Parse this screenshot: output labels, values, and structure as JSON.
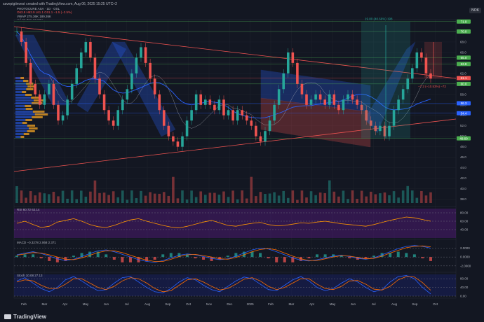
{
  "header": {
    "text": "savepigtinvest created with TradingView.com, Aug 06, 2025 15:25 UTC+2"
  },
  "legend": {
    "symbol": "PHOTOCURE ASA · 1D · OSL",
    "ohlc": "O63.9 H63.9 L61.1 C61.1 −1.5 (−2.5%)",
    "vwap": "VWAP 275.36K  189.26K",
    "vol": "Vol  96.78K  82.53K",
    "sma1": "SMA  56.7",
    "sma2": "SMA  54.4"
  },
  "currency": "NOK",
  "chart_data": {
    "type": "line",
    "title": "PHOTOCURE ASA · 1D · OSL",
    "x_ticks": [
      "Feb",
      "Mar",
      "Apr",
      "May",
      "Jun",
      "Jul",
      "Aug",
      "Sep",
      "Oct",
      "Nov",
      "Dec",
      "2025",
      "Feb",
      "Mar",
      "Apr",
      "May",
      "Jun",
      "Jul",
      "Aug",
      "Sep",
      "Oct"
    ],
    "price_axis": {
      "ylim": [
        37,
        72
      ],
      "ticks": [
        38,
        40,
        42,
        44,
        46,
        48,
        50,
        52,
        54,
        56,
        58,
        60,
        62,
        64,
        66,
        68,
        70
      ]
    },
    "price_labels": [
      {
        "text": "71.9",
        "value": 71.9,
        "color": "#4caf50"
      },
      {
        "text": "70.0",
        "value": 70.0,
        "color": "#4caf50"
      },
      {
        "text": "65.0",
        "value": 65.0,
        "color": "#4caf50"
      },
      {
        "text": "63.8",
        "value": 63.8,
        "color": "#4caf50"
      },
      {
        "text": "61.1",
        "value": 61.1,
        "color": "#ef5350"
      },
      {
        "text": "60.0",
        "value": 60.0,
        "color": "#4caf50"
      },
      {
        "text": "56.3",
        "value": 56.3,
        "color": "#2962ff"
      },
      {
        "text": "54.4",
        "value": 54.4,
        "color": "#2962ff"
      },
      {
        "text": "49.60",
        "value": 49.6,
        "color": "#4caf50"
      }
    ],
    "annotations": {
      "measure_up": "19.80 (40.66%) 198",
      "measure_down": "−7.2 (−10.53%) −72"
    },
    "price_close": [
      70,
      68,
      64,
      60,
      58,
      56,
      58,
      60,
      56,
      53,
      54,
      57,
      60,
      63,
      66,
      68,
      65,
      61,
      58,
      55,
      53,
      52,
      55,
      57,
      59,
      62,
      65,
      67,
      64,
      61,
      58,
      55,
      52,
      50,
      49,
      48,
      50,
      53,
      55,
      58,
      56,
      57,
      56,
      55,
      57,
      54,
      55,
      53,
      55,
      54,
      53,
      52,
      50,
      49,
      51,
      53,
      56,
      59,
      62,
      66,
      64,
      60,
      58,
      56,
      57,
      58,
      57,
      56,
      58,
      56,
      55,
      57,
      58,
      57,
      56,
      55,
      53,
      52,
      51,
      52,
      50,
      52,
      55,
      57,
      59,
      61,
      63,
      66,
      65,
      62,
      61
    ],
    "rsi": {
      "label": "RSI  60.72  62.14",
      "ylim": [
        20,
        90
      ],
      "ticks": [
        40,
        60,
        80
      ],
      "values": [
        55,
        60,
        52,
        45,
        48,
        58,
        62,
        66,
        60,
        52,
        47,
        45,
        50,
        57,
        63,
        66,
        60,
        55,
        50,
        46,
        44,
        48,
        53,
        58,
        62,
        56,
        50,
        48,
        52,
        55,
        57,
        52,
        49,
        50,
        53,
        56,
        55,
        58,
        60,
        57,
        54,
        52,
        50,
        48,
        52,
        57,
        62,
        66,
        70,
        68,
        64,
        60
      ]
    },
    "macd": {
      "label": "MACD  −0.3278  2.068  2.371",
      "ylim": [
        -2.5,
        3.5
      ],
      "ticks": [
        2.0,
        0.0,
        -2.0
      ],
      "macd": [
        0.5,
        0.9,
        1.2,
        0.8,
        0.2,
        -0.4,
        -0.8,
        -0.5,
        0.1,
        0.8,
        1.4,
        1.6,
        1.2,
        0.6,
        0,
        -0.6,
        -1.0,
        -1.2,
        -0.8,
        -0.2,
        0.4,
        0.7,
        0.5,
        0.1,
        -0.3,
        -0.6,
        -0.4,
        0.2,
        0.9,
        1.6,
        2.0,
        1.8,
        1.2,
        0.5,
        -0.2,
        -0.7,
        -0.9,
        -0.6,
        -0.2,
        0.2,
        0.4,
        0.1,
        -0.3,
        -0.5,
        -0.2,
        0.5,
        1.2,
        1.9,
        2.4,
        2.6,
        2.4,
        2.0
      ],
      "signal": [
        0.4,
        0.7,
        1.0,
        0.9,
        0.5,
        0,
        -0.5,
        -0.6,
        -0.2,
        0.4,
        1.0,
        1.4,
        1.4,
        1.0,
        0.4,
        -0.2,
        -0.7,
        -1.0,
        -1.0,
        -0.5,
        0.1,
        0.5,
        0.6,
        0.3,
        0,
        -0.4,
        -0.5,
        -0.1,
        0.5,
        1.2,
        1.7,
        1.9,
        1.6,
        0.9,
        0.2,
        -0.4,
        -0.8,
        -0.8,
        -0.4,
        0,
        0.3,
        0.2,
        -0.1,
        -0.4,
        -0.3,
        0.2,
        0.9,
        1.5,
        2.1,
        2.4,
        2.5,
        2.3
      ]
    },
    "stoch": {
      "label": "Stoch  10.08  27.13",
      "ylim": [
        0,
        100
      ],
      "ticks": [
        80,
        40,
        0
      ],
      "k": [
        70,
        85,
        60,
        35,
        20,
        40,
        75,
        90,
        70,
        45,
        25,
        30,
        60,
        85,
        90,
        65,
        40,
        20,
        15,
        35,
        65,
        85,
        75,
        50,
        30,
        20,
        45,
        70,
        88,
        80,
        55,
        30,
        25,
        50,
        75,
        90,
        70,
        40,
        25,
        35,
        60,
        80,
        65,
        40,
        20,
        30,
        65,
        90,
        95,
        80,
        40,
        10
      ],
      "d": [
        65,
        75,
        70,
        50,
        35,
        35,
        55,
        80,
        80,
        60,
        40,
        30,
        45,
        70,
        85,
        80,
        60,
        35,
        20,
        25,
        50,
        75,
        80,
        65,
        45,
        28,
        35,
        55,
        78,
        85,
        70,
        45,
        30,
        40,
        60,
        80,
        80,
        55,
        35,
        30,
        45,
        70,
        72,
        55,
        32,
        28,
        45,
        75,
        90,
        88,
        62,
        27
      ]
    }
  }
}
